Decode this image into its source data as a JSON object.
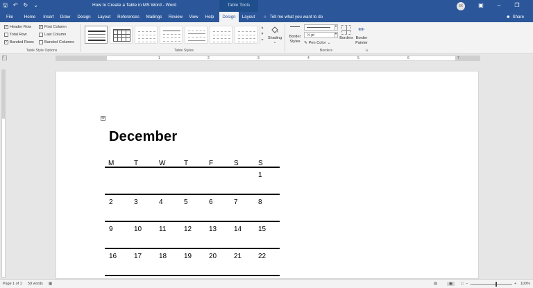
{
  "window": {
    "title": "How to Create a Table in MS Word  -  Word",
    "context_tab_label": "Table Tools",
    "user_initials": "SK",
    "share_label": "Share",
    "tell_me": "Tell me what you want to do"
  },
  "tabs": [
    {
      "label": "File"
    },
    {
      "label": "Home"
    },
    {
      "label": "Insert"
    },
    {
      "label": "Draw"
    },
    {
      "label": "Design"
    },
    {
      "label": "Layout"
    },
    {
      "label": "References"
    },
    {
      "label": "Mailings"
    },
    {
      "label": "Review"
    },
    {
      "label": "View"
    },
    {
      "label": "Help"
    },
    {
      "label": "Design",
      "active": true
    },
    {
      "label": "Layout"
    }
  ],
  "ribbon": {
    "style_options": {
      "group_label": "Table Style Options",
      "items": [
        {
          "label": "Header Row",
          "checked": true
        },
        {
          "label": "First Column",
          "checked": true
        },
        {
          "label": "Total Row",
          "checked": false
        },
        {
          "label": "Last Column",
          "checked": false
        },
        {
          "label": "Banded Rows",
          "checked": true
        },
        {
          "label": "Banded Columns",
          "checked": false
        }
      ]
    },
    "table_styles": {
      "group_label": "Table Styles"
    },
    "shading_label": "Shading",
    "borders": {
      "group_label": "Borders",
      "border_styles_label1": "Border",
      "border_styles_label2": "Styles",
      "weight": "½ pt",
      "pen_color_label": "Pen Color",
      "borders_label": "Borders",
      "painter_label1": "Border",
      "painter_label2": "Painter"
    }
  },
  "ruler_numbers": [
    "1",
    "2",
    "3",
    "4",
    "5",
    "6",
    "7"
  ],
  "document": {
    "month": "December",
    "weekdays": [
      "M",
      "T",
      "W",
      "T",
      "F",
      "S",
      "S"
    ],
    "weeks": [
      [
        "",
        "",
        "",
        "",
        "",
        "",
        "1"
      ],
      [
        "2",
        "3",
        "4",
        "5",
        "6",
        "7",
        "8"
      ],
      [
        "9",
        "10",
        "11",
        "12",
        "13",
        "14",
        "15"
      ],
      [
        "16",
        "17",
        "18",
        "19",
        "20",
        "21",
        "22"
      ]
    ]
  },
  "status": {
    "page": "Page 1 of 1",
    "words": "59 words",
    "zoom": "100%"
  }
}
